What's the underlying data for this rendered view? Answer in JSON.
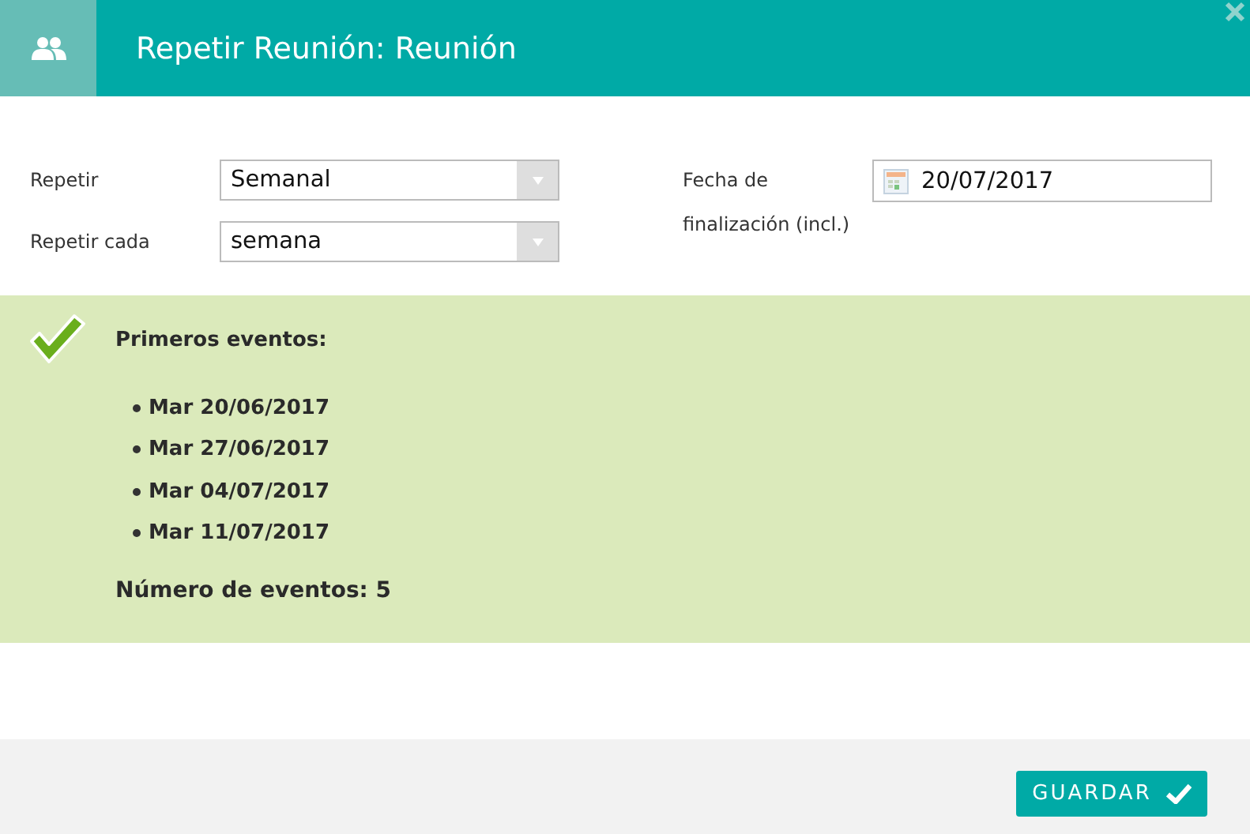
{
  "window": {
    "title": "Repetir Reunión: Reunión"
  },
  "form": {
    "repeat": {
      "label": "Repetir",
      "value": "Semanal"
    },
    "repeat_every": {
      "label": "Repetir cada",
      "value": "semana"
    },
    "end_date": {
      "label": "Fecha de finalización (incl.)",
      "value": "20/07/2017"
    }
  },
  "preview": {
    "heading": "Primeros eventos:",
    "events": [
      "Mar 20/06/2017",
      "Mar 27/06/2017",
      "Mar 04/07/2017",
      "Mar 11/07/2017"
    ],
    "count": "Número de eventos: 5"
  },
  "buttons": [
    {
      "label": "GUARDAR"
    }
  ]
}
